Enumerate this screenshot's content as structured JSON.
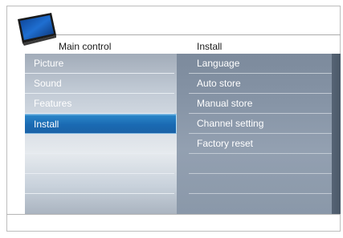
{
  "header": {
    "left_title": "Main control",
    "right_title": "Install"
  },
  "icon": "tv-icon",
  "left_menu": {
    "items": [
      {
        "label": "Picture"
      },
      {
        "label": "Sound"
      },
      {
        "label": "Features"
      },
      {
        "label": "Install",
        "selected": true
      },
      {
        "label": ""
      },
      {
        "label": ""
      },
      {
        "label": ""
      },
      {
        "label": ""
      }
    ]
  },
  "right_menu": {
    "items": [
      {
        "label": "Language"
      },
      {
        "label": "Auto store"
      },
      {
        "label": "Manual store"
      },
      {
        "label": "Channel setting"
      },
      {
        "label": "Factory reset"
      },
      {
        "label": ""
      },
      {
        "label": ""
      },
      {
        "label": ""
      }
    ]
  },
  "colors": {
    "selected_highlight": "#1a6ab3",
    "left_panel": "#c0c9d4",
    "right_panel": "#8694a6"
  }
}
